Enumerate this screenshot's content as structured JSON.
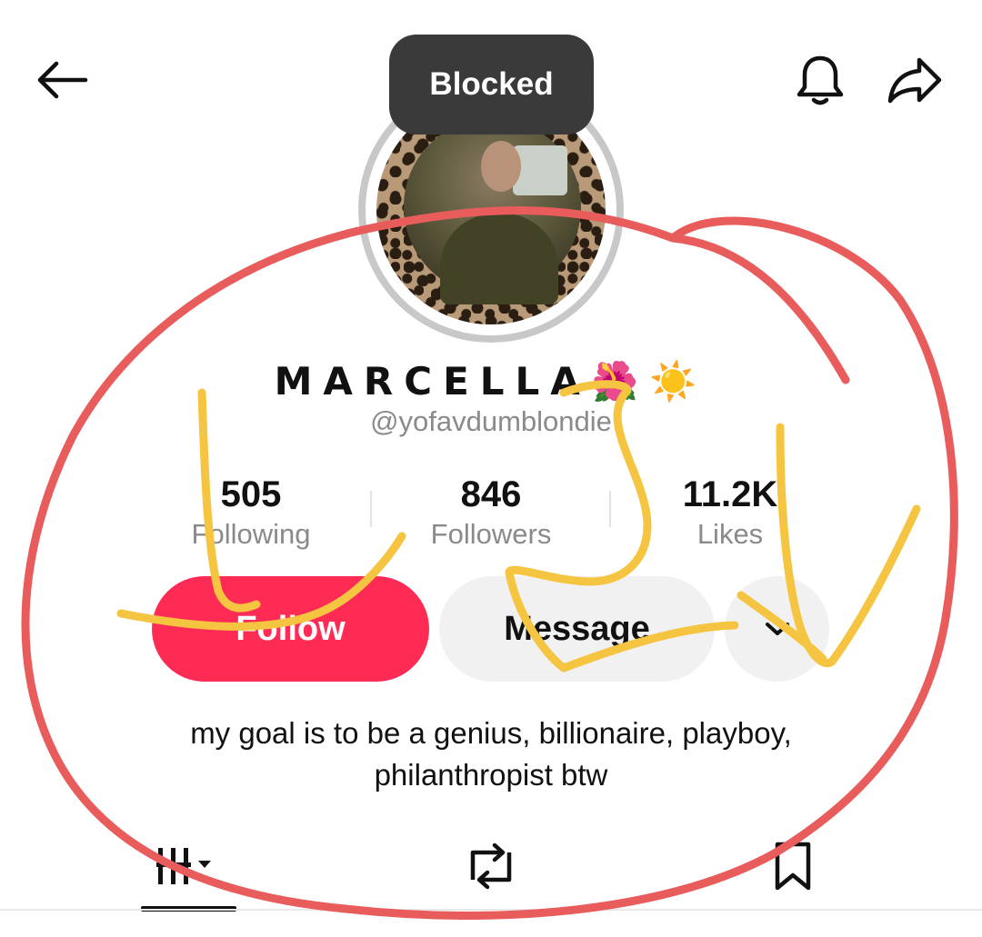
{
  "header": {
    "back_icon": "arrow-left-icon",
    "bell_icon": "bell-icon",
    "share_icon": "share-arrow-icon"
  },
  "toast": {
    "text": "Blocked"
  },
  "profile": {
    "display_name": "MARCELLA🌺☀️",
    "handle": "@yofavdumblondie",
    "bio_line1": "my goal is to be a genius, billionaire, playboy,",
    "bio_line2": "philanthropist btw"
  },
  "stats": {
    "following": {
      "value": "505",
      "label": "Following"
    },
    "followers": {
      "value": "846",
      "label": "Followers"
    },
    "likes": {
      "value": "11.2K",
      "label": "Likes"
    }
  },
  "actions": {
    "follow_label": "Follow",
    "message_label": "Message",
    "more_icon": "chevron-down-icon"
  },
  "tabs": [
    {
      "icon": "videos-grid-icon",
      "active": true
    },
    {
      "icon": "repost-icon",
      "active": false
    },
    {
      "icon": "bookmark-icon",
      "active": false
    }
  ],
  "colors": {
    "follow": "#fe2c55",
    "secondary_button": "#f1f1f2",
    "toast_bg": "#3a3a3a",
    "muted_text": "#8a8a8a",
    "annotation_red": "#e85c5c",
    "annotation_yellow": "#f5c440"
  }
}
